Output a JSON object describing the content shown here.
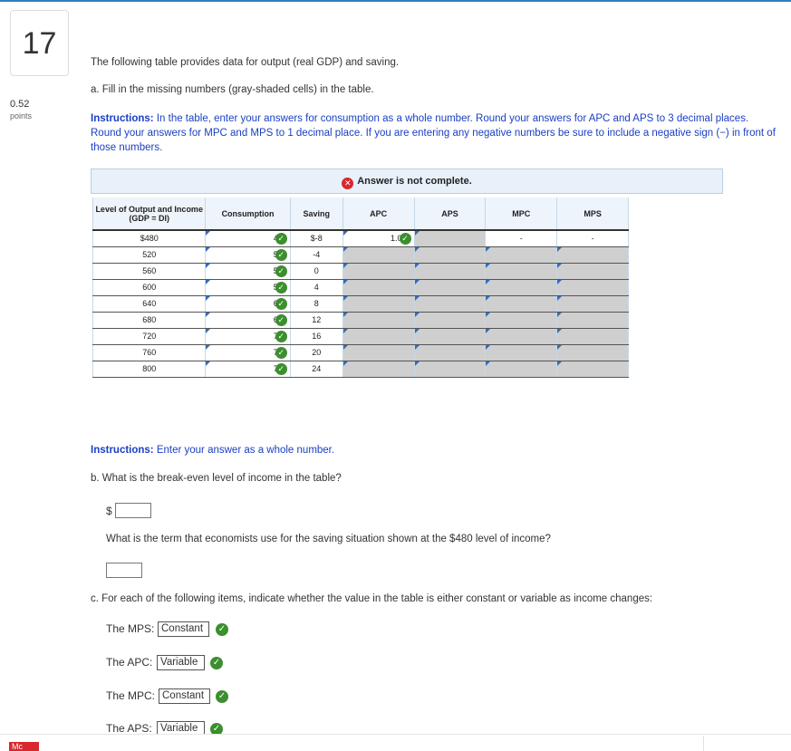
{
  "question": {
    "number": "17",
    "points_value": "0.52",
    "points_label": "points"
  },
  "intro": "The following table provides data for output (real GDP) and saving.",
  "part_a": "a. Fill in the missing numbers (gray-shaded cells) in the table.",
  "instructions": {
    "label": "Instructions:",
    "text": " In the table, enter your answers for consumption as a whole number. Round your answers for APC and APS to 3 decimal places. Round your answers for MPC and MPS to 1 decimal place. If you are entering any negative numbers be sure to include a negative sign (−) in front of those numbers."
  },
  "banner": "Answer is not complete.",
  "table": {
    "headers": [
      "Level of Output and Income (GDP = DI)",
      "Consumption",
      "Saving",
      "APC",
      "APS",
      "MPC",
      "MPS"
    ],
    "rows": [
      {
        "level": "$480",
        "consumption": "488",
        "saving": "$-8",
        "apc": "1.017",
        "mpc": "-",
        "mps": "-"
      },
      {
        "level": "520",
        "consumption": "524",
        "saving": "-4"
      },
      {
        "level": "560",
        "consumption": "560",
        "saving": "0"
      },
      {
        "level": "600",
        "consumption": "596",
        "saving": "4"
      },
      {
        "level": "640",
        "consumption": "632",
        "saving": "8"
      },
      {
        "level": "680",
        "consumption": "668",
        "saving": "12"
      },
      {
        "level": "720",
        "consumption": "704",
        "saving": "16"
      },
      {
        "level": "760",
        "consumption": "740",
        "saving": "20"
      },
      {
        "level": "800",
        "consumption": "776",
        "saving": "24"
      }
    ]
  },
  "instructions2": {
    "label": "Instructions:",
    "text": " Enter your answer as a whole number."
  },
  "part_b": "b. What is the break-even level of income in the table?",
  "dollar_sign": "$",
  "part_b_term": "What is the term that economists use for the saving situation shown at the $480 level of income?",
  "part_c": "c. For each of the following items, indicate whether the value in the table is either constant or variable as income changes:",
  "answers_c": [
    {
      "label": "The MPS:",
      "value": "Constant"
    },
    {
      "label": "The APC:",
      "value": "Variable"
    },
    {
      "label": "The MPC:",
      "value": "Constant"
    },
    {
      "label": "The APS:",
      "value": "Variable"
    }
  ],
  "footer_logo": "Mc"
}
